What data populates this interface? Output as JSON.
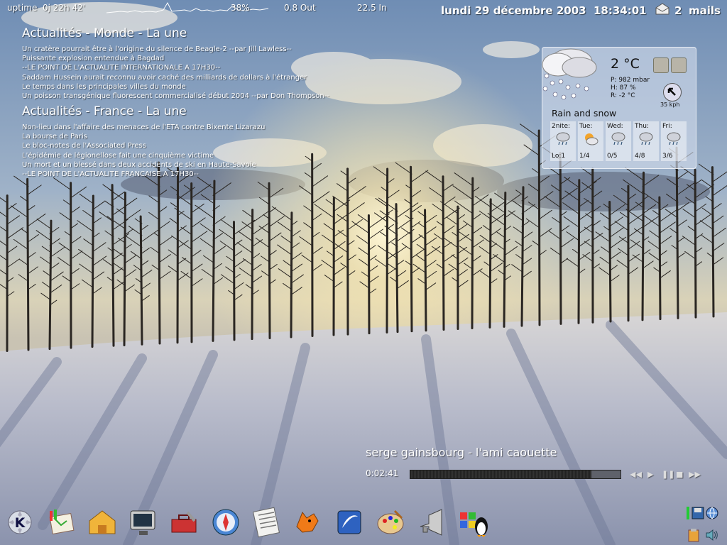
{
  "topbar": {
    "uptime_label": "uptime",
    "uptime_value": "0j 22h 42'",
    "cpu": "38%",
    "net_out": "0.8 Out",
    "net_in": "22.5 In",
    "date": "lundi 29 décembre 2003",
    "time": "18:34:01",
    "mail_count": "2",
    "mail_label": "mails"
  },
  "news": [
    {
      "title": "Actualités - Monde - La une",
      "items": [
        "Un cratère pourrait être à l'origine du silence de Beagle-2 --par Jill Lawless--",
        "Puissante explosion entendue à Bagdad",
        "--LE POINT DE L'ACTUALITE INTERNATIONALE A 17H30--",
        "Saddam Hussein aurait reconnu avoir caché des milliards de dollars à l'étranger",
        "Le temps dans les principales villes du monde",
        "Un poisson transgénique fluorescent commercialisé début 2004 --par Don Thompson--"
      ]
    },
    {
      "title": "Actualités - France - La une",
      "items": [
        "Non-lieu dans l'affaire des menaces de l'ETA contre Bixente Lizarazu",
        "La bourse de Paris",
        "Le bloc-notes de l'Associated Press",
        "L'épidémie de légionellose fait une cinquième victime",
        "Un mort et un blessé dans deux accidents de ski en Haute-Savoie",
        "--LE POINT DE L'ACTUALITE FRANCAISE A 17H30--"
      ]
    }
  ],
  "weather": {
    "temperature": "2 °C",
    "pressure": "P:  982 mbar",
    "humidity": "H:  87 %",
    "real_feel": "R:  -2 °C",
    "wind": "35 kph",
    "condition": "Rain and snow",
    "forecast": [
      {
        "day": "2nite:",
        "temps": "Lo:1",
        "icon": "rain-icon"
      },
      {
        "day": "Tue:",
        "temps": "1/4",
        "icon": "sun-cloud-icon"
      },
      {
        "day": "Wed:",
        "temps": "0/5",
        "icon": "rain-icon"
      },
      {
        "day": "Thu:",
        "temps": "4/8",
        "icon": "rain-icon"
      },
      {
        "day": "Fri:",
        "temps": "3/6",
        "icon": "rain-icon"
      }
    ]
  },
  "player": {
    "song": "serge gainsbourg - l'ami caouette",
    "elapsed": "0:02:41",
    "progress": 0.86
  },
  "dock": [
    {
      "name": "kde-menu-icon"
    },
    {
      "name": "paint-easel-icon"
    },
    {
      "name": "home-folder-icon"
    },
    {
      "name": "monitor-settings-icon"
    },
    {
      "name": "toolbox-icon"
    },
    {
      "name": "konqueror-compass-icon"
    },
    {
      "name": "newspaper-icon"
    },
    {
      "name": "mascot-dragon-icon"
    },
    {
      "name": "openoffice-icon"
    },
    {
      "name": "palette-icon"
    },
    {
      "name": "speaker-horn-icon"
    },
    {
      "name": "windows-tux-icon"
    }
  ],
  "colors": {
    "sky_top": "#7f9bbd",
    "sun": "#fff3cc",
    "snow": "#c9cdd8",
    "shadow": "#6d7793"
  }
}
